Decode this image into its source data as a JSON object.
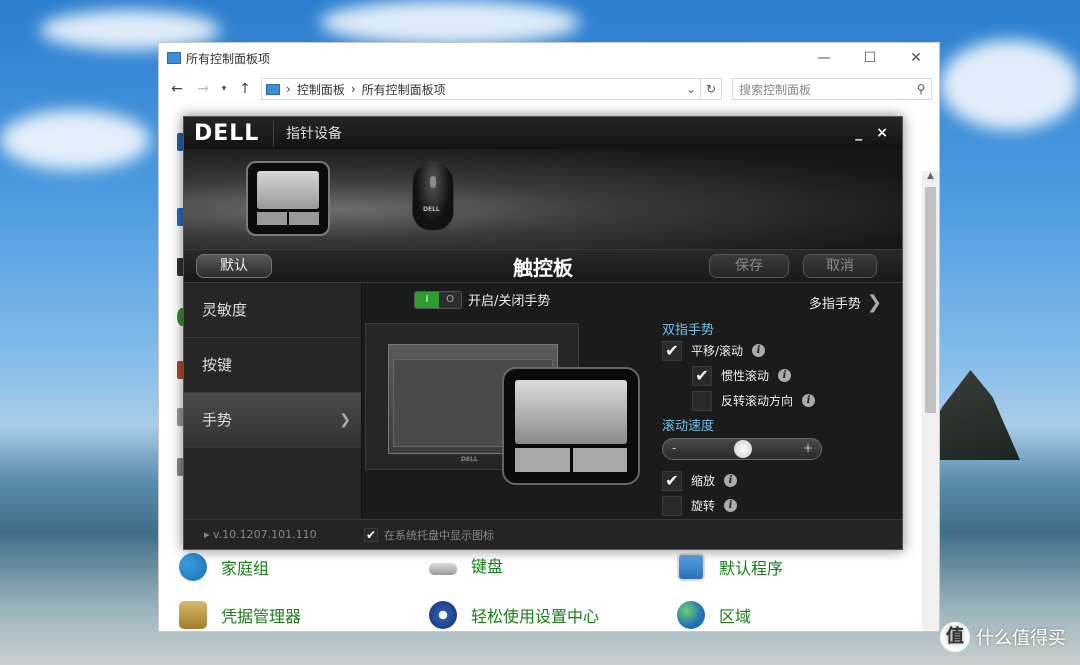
{
  "explorer": {
    "window_title": "所有控制面板项",
    "breadcrumb": [
      "控制面板",
      "所有控制面板项"
    ],
    "search_placeholder": "搜索控制面板",
    "items": [
      {
        "label": "家庭组",
        "icon": "homegroup-icon"
      },
      {
        "label": "键盘",
        "icon": "keyboard-icon"
      },
      {
        "label": "默认程序",
        "icon": "default-programs-icon"
      },
      {
        "label": "凭据管理器",
        "icon": "credential-manager-icon"
      },
      {
        "label": "轻松使用设置中心",
        "icon": "ease-of-access-icon"
      },
      {
        "label": "区域",
        "icon": "region-icon"
      }
    ]
  },
  "dell": {
    "logo": "DELL",
    "title": "指针设备",
    "minimize": "_",
    "close": "×",
    "devices": [
      "touchpad-icon",
      "mouse-icon"
    ],
    "default_button": "默认",
    "panel_title": "触控板",
    "save_button": "保存",
    "cancel_button": "取消",
    "sidebar": [
      {
        "label": "灵敏度"
      },
      {
        "label": "按键"
      },
      {
        "label": "手势",
        "active": true
      }
    ],
    "toggle_on": "I",
    "toggle_off": "O",
    "gesture_toggle_label": "开启/关闭手势",
    "multi_finger_link": "多指手势",
    "two_finger_title": "双指手势",
    "options": [
      {
        "label": "平移/滚动",
        "checked": true
      },
      {
        "label": "惯性滚动",
        "checked": true
      },
      {
        "label": "反转滚动方向",
        "checked": false
      }
    ],
    "scroll_speed_title": "滚动速度",
    "scroll_speed_minus": "-",
    "scroll_speed_plus": "+",
    "scroll_speed_level": 0.5,
    "zoom": {
      "label": "缩放",
      "checked": true
    },
    "rotate": {
      "label": "旋转",
      "checked": false
    },
    "version": "v.10.1207.101.110",
    "show_tray_icon": {
      "label": "在系统托盘中显示图标",
      "checked": true
    }
  },
  "watermark": "什么值得买",
  "watermark_badge": "值",
  "colors": {
    "accent_blue": "#6fc0e8",
    "toggle_green": "#2f9c2f",
    "link_green": "#1a7d1a"
  }
}
